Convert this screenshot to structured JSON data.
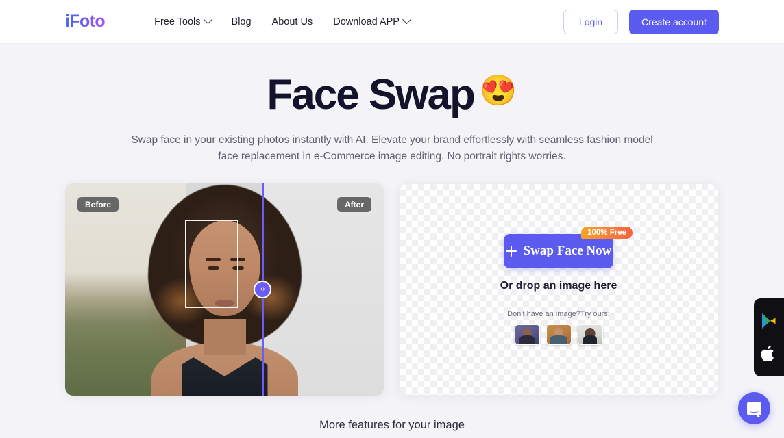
{
  "header": {
    "logo": "iFoto",
    "nav": [
      {
        "label": "Free Tools",
        "has_caret": true
      },
      {
        "label": "Blog",
        "has_caret": false
      },
      {
        "label": "About Us",
        "has_caret": false
      },
      {
        "label": "Download APP",
        "has_caret": true
      }
    ],
    "login_label": "Login",
    "create_account_label": "Create account"
  },
  "hero": {
    "title": "Face Swap",
    "title_emoji": "😍",
    "subtitle": "Swap face in your existing photos instantly with AI. Elevate your brand effortlessly with seamless fashion model face replacement in e-Commerce image editing. No portrait rights worries."
  },
  "compare": {
    "before_label": "Before",
    "after_label": "After",
    "handle_glyph": "‹›",
    "divider_position_percent": 62
  },
  "upload": {
    "badge_label": "100% Free",
    "swap_button_label": "Swap Face Now",
    "plus_icon": "plus-icon",
    "drop_hint": "Or drop an image here",
    "samples_label": "Don't have an image?Try ours:",
    "samples": [
      {
        "name": "sample-1"
      },
      {
        "name": "sample-2"
      },
      {
        "name": "sample-3"
      }
    ]
  },
  "footer": {
    "more_features": "More features for your image"
  },
  "widgets": {
    "google_play_icon": "google-play-icon",
    "apple_icon": "apple-icon",
    "chat_icon": "chat-bubble-icon"
  },
  "colors": {
    "accent": "#5b5bf0",
    "badge_gradient_start": "#f5a524",
    "badge_gradient_end": "#f4613f",
    "page_background": "#f4f4f8",
    "title": "#13132b"
  }
}
